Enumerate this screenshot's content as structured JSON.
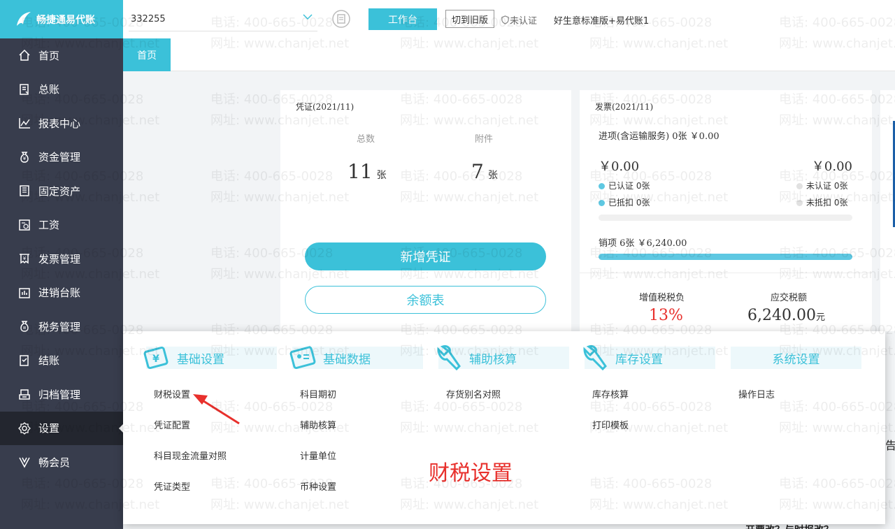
{
  "brand": {
    "name": "畅捷通易代账"
  },
  "sidebar": {
    "items": [
      {
        "label": "首页",
        "icon": "home-icon"
      },
      {
        "label": "总账",
        "icon": "ledger-icon"
      },
      {
        "label": "报表中心",
        "icon": "chart-icon"
      },
      {
        "label": "资金管理",
        "icon": "money-bag-icon"
      },
      {
        "label": "固定资产",
        "icon": "building-icon"
      },
      {
        "label": "工资",
        "icon": "salary-icon"
      },
      {
        "label": "发票管理",
        "icon": "invoice-icon"
      },
      {
        "label": "进销台账",
        "icon": "inventory-icon"
      },
      {
        "label": "税务管理",
        "icon": "tax-icon"
      },
      {
        "label": "结账",
        "icon": "checkout-icon"
      },
      {
        "label": "归档管理",
        "icon": "archive-icon"
      },
      {
        "label": "设置",
        "icon": "gear-icon",
        "active": true
      },
      {
        "label": "畅会员",
        "icon": "vip-icon"
      }
    ]
  },
  "topbar": {
    "company": "332255",
    "workbench_label": "工作台",
    "switch_label": "切到旧版",
    "cert_label": "未认证",
    "edition": "好生意标准版+易代账1"
  },
  "tabs": {
    "home": "首页"
  },
  "voucher": {
    "title": "凭证(2021/11)",
    "total_label": "总数",
    "attach_label": "附件",
    "total_value": "11",
    "attach_value": "7",
    "unit": "张",
    "new_button": "新增凭证",
    "balance_button": "余额表"
  },
  "invoice": {
    "title": "发票(2021/11)",
    "input_line": "进项(含运输服务) 0张 ￥0.00",
    "left_amount": "￥0.00",
    "right_amount": "￥0.00",
    "certified": "已认证  0张",
    "uncertified": "未认证  0张",
    "deducted": "已抵扣  0张",
    "undeducted": "未抵扣  0张",
    "output_line": "销项   6张   ￥6,240.00",
    "output_fill": 1.0,
    "vat_label": "增值税税负",
    "vat_value": "13%",
    "tax_label": "应交税额",
    "tax_value": "6,240.00",
    "tax_unit": "元"
  },
  "popup": {
    "columns": [
      {
        "title": "基础设置",
        "icon": "settings-card-icon",
        "items": [
          "财税设置",
          "凭证配置",
          "科目现金流量对照",
          "凭证类型"
        ]
      },
      {
        "title": "基础数据",
        "icon": "data-card-icon",
        "items": [
          "科目期初",
          "辅助核算",
          "计量单位",
          "币种设置"
        ]
      },
      {
        "title": "辅助核算",
        "icon": "wrench-icon",
        "items": [
          "存货别名对照"
        ]
      },
      {
        "title": "库存设置",
        "icon": "wrench-icon",
        "items": [
          "库存核算",
          "打印模板"
        ]
      },
      {
        "title": "系统设置",
        "icon": "",
        "items": [
          "操作日志"
        ]
      }
    ],
    "overlay_text": "财税设置"
  },
  "background": {
    "bottom_text": "开票改？与时报改？",
    "side_char": "告"
  },
  "watermark": {
    "phone": "电话: 400-665-0028",
    "site": "网址: www.chanjet.net"
  },
  "colors": {
    "accent": "#3bc1d9",
    "sidebar": "#383d4d",
    "active": "#23262f",
    "red": "#e8302c"
  }
}
